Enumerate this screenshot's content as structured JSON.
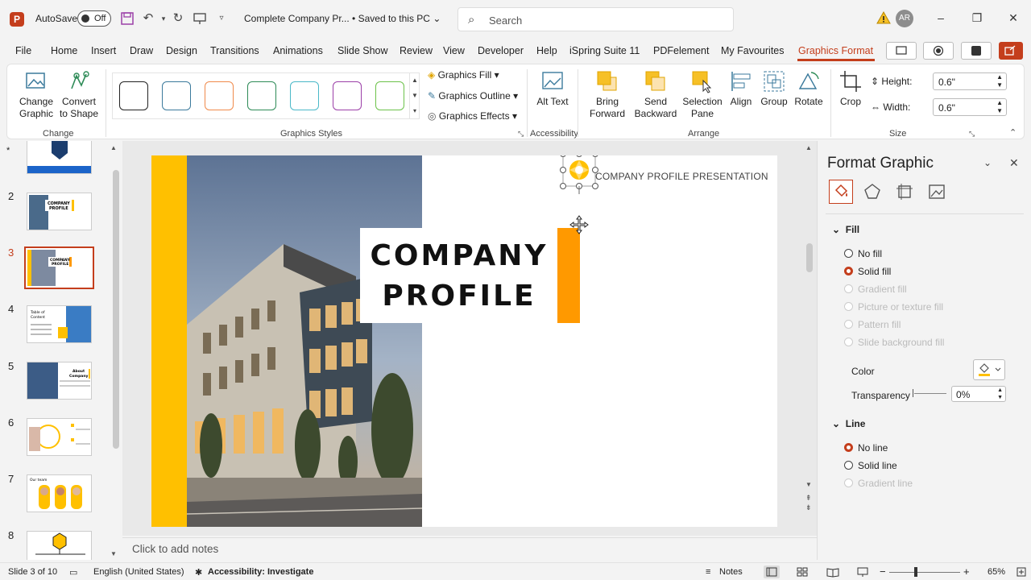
{
  "titlebar": {
    "app_letter": "P",
    "autosave_label": "AutoSave",
    "toggle_state": "Off",
    "doc_title": "Complete Company Pr... • Saved to this PC",
    "search_placeholder": "Search",
    "user_initials": "AR"
  },
  "menu": {
    "items": [
      "File",
      "Home",
      "Insert",
      "Draw",
      "Design",
      "Transitions",
      "Animations",
      "Slide Show",
      "Review",
      "View",
      "Developer",
      "Help",
      "iSpring Suite 11",
      "PDFelement",
      "My Favourites",
      "Graphics Format"
    ],
    "active": "Graphics Format"
  },
  "ribbon": {
    "change_graphic": "Change Graphic",
    "convert_to_shape": "Convert to Shape",
    "group_change": "Change",
    "group_styles": "Graphics Styles",
    "graphics_fill": "Graphics Fill",
    "graphics_outline": "Graphics Outline",
    "graphics_effects": "Graphics Effects",
    "alt_text": "Alt Text",
    "group_accessibility": "Accessibility",
    "bring_forward": "Bring Forward",
    "send_backward": "Send Backward",
    "selection_pane": "Selection Pane",
    "align": "Align",
    "group": "Group",
    "rotate": "Rotate",
    "group_arrange": "Arrange",
    "crop": "Crop",
    "height_label": "Height:",
    "height_value": "0.6\"",
    "width_label": "Width:",
    "width_value": "0.6\"",
    "group_size": "Size",
    "style_colors": [
      "#222222",
      "#3b7a9c",
      "#f08a4b",
      "#2e8b57",
      "#4ab8c8",
      "#9b3fa8",
      "#6cc24a"
    ]
  },
  "thumbnails": {
    "numbers": [
      "2",
      "3",
      "4",
      "5",
      "6",
      "7",
      "8"
    ],
    "selected": "3"
  },
  "slide": {
    "title_line1": "COMPANY",
    "title_line2": "PROFILE",
    "subtitle": "COMPANY PROFILE PRESENTATION"
  },
  "notes": {
    "placeholder": "Click to add notes"
  },
  "format_pane": {
    "title": "Format Graphic",
    "fill_section": "Fill",
    "fill_options": [
      "No fill",
      "Solid fill",
      "Gradient fill",
      "Picture or texture fill",
      "Pattern fill",
      "Slide background fill"
    ],
    "fill_selected": "Solid fill",
    "color_label": "Color",
    "transparency_label": "Transparency",
    "transparency_value": "0%",
    "line_section": "Line",
    "line_options": [
      "No line",
      "Solid line",
      "Gradient line"
    ],
    "line_selected": "No line"
  },
  "status": {
    "slide_count": "Slide 3 of 10",
    "language": "English (United States)",
    "accessibility": "Accessibility: Investigate",
    "notes": "Notes",
    "zoom": "65%"
  },
  "colors": {
    "accent": "#c43e1c",
    "yellow": "#ffc000",
    "orange": "#ff9900"
  }
}
